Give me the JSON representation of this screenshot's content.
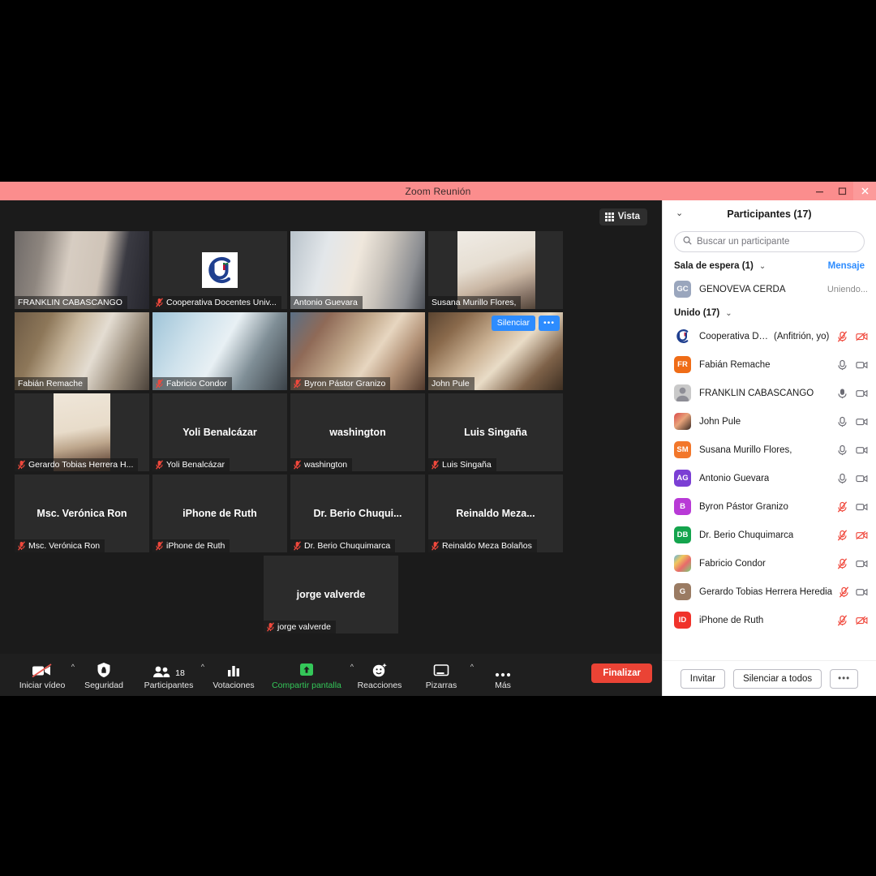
{
  "window": {
    "title": "Zoom Reunión",
    "controls": {
      "minimize": "minimize-icon",
      "maximize": "maximize-icon",
      "close": "close-icon"
    }
  },
  "meeting": {
    "view_button": "Vista",
    "tiles": [
      [
        {
          "name": "FRANKLIN CABASCANGO",
          "label": "FRANKLIN CABASCANGO",
          "muted": false,
          "active": true,
          "video": true,
          "photo": "frame-a"
        },
        {
          "name": "Cooperativa Docentes Univ...",
          "label": "Cooperativa Docentes Univ...",
          "muted": true,
          "active": false,
          "video": true,
          "photo": "coop-logo"
        },
        {
          "name": "Antonio Guevara",
          "label": "Antonio Guevara",
          "muted": false,
          "active": false,
          "video": true,
          "photo": "frame-c"
        },
        {
          "name": "Susana Murillo Flores,",
          "label": "Susana Murillo Flores,",
          "muted": false,
          "active": false,
          "video": true,
          "photo": "frame-d"
        }
      ],
      [
        {
          "name": "Fabián Remache",
          "label": "Fabián Remache",
          "muted": false,
          "active": false,
          "video": true,
          "photo": "frame-e"
        },
        {
          "name": "Fabricio Condor",
          "label": "Fabricio Condor",
          "muted": true,
          "active": false,
          "video": true,
          "photo": "frame-f"
        },
        {
          "name": "Byron Pástor Granizo",
          "label": "Byron Pástor Granizo",
          "muted": true,
          "active": false,
          "video": true,
          "photo": "frame-g"
        },
        {
          "name": "John Pule",
          "label": "John Pule",
          "muted": false,
          "active": false,
          "video": true,
          "photo": "frame-h",
          "hover": {
            "mute": "Silenciar",
            "more": "•••"
          }
        }
      ],
      [
        {
          "name": "Gerardo Tobias Herrera H...",
          "label": "Gerardo Tobias Herrera H...",
          "muted": true,
          "active": false,
          "video": true,
          "photo": "frame-i"
        },
        {
          "name": "Yoli Benalcázar",
          "label": "Yoli Benalcázar",
          "muted": true,
          "active": false,
          "video": false
        },
        {
          "name": "washington",
          "label": "washington",
          "muted": true,
          "active": false,
          "video": false
        },
        {
          "name": "Luis Singaña",
          "label": "Luis Singaña",
          "muted": true,
          "active": false,
          "video": false
        }
      ],
      [
        {
          "name": "Msc. Verónica Ron",
          "label": "Msc. Verónica Ron",
          "muted": true,
          "active": false,
          "video": false
        },
        {
          "name": "iPhone de Ruth",
          "label": "iPhone de Ruth",
          "muted": true,
          "active": false,
          "video": false
        },
        {
          "name": "Dr.  Berio Chuqui...",
          "label": "Dr. Berio Chuquimarca",
          "muted": true,
          "active": false,
          "video": false
        },
        {
          "name": "Reinaldo  Meza...",
          "label": "Reinaldo Meza Bolaños",
          "muted": true,
          "active": false,
          "video": false
        }
      ],
      [
        {
          "name": "jorge valverde",
          "label": "jorge valverde",
          "muted": true,
          "active": false,
          "video": false
        }
      ]
    ],
    "toolbar": {
      "video": {
        "label": "Iniciar vídeo",
        "icon": "camera-off-icon",
        "caret": true
      },
      "security": {
        "label": "Seguridad",
        "icon": "shield-icon",
        "caret": false
      },
      "participants": {
        "label": "Participantes",
        "icon": "people-icon",
        "count": "18",
        "caret": true
      },
      "polls": {
        "label": "Votaciones",
        "icon": "poll-bars-icon",
        "caret": false
      },
      "share": {
        "label": "Compartir pantalla",
        "icon": "share-screen-icon",
        "caret": true
      },
      "reactions": {
        "label": "Reacciones",
        "icon": "smiley-icon",
        "caret": false
      },
      "whiteboards": {
        "label": "Pizarras",
        "icon": "whiteboard-icon",
        "caret": true
      },
      "more": {
        "label": "Más",
        "icon": "ellipsis-icon",
        "caret": false
      },
      "end": {
        "label": "Finalizar"
      }
    }
  },
  "panel": {
    "title": "Participantes (17)",
    "search_placeholder": "Buscar un participante",
    "waiting_room": {
      "title": "Sala de espera (1)",
      "action": "Mensaje",
      "rows": [
        {
          "initials": "GC",
          "name": "GENOVEVA CERDA",
          "status": "Uniendo...",
          "color": "#9aa6bd"
        }
      ]
    },
    "joined": {
      "title": "Unido (17)",
      "rows": [
        {
          "initials": "",
          "name": "Cooperativa Doc...",
          "meta": "(Anfitrión, yo)",
          "color": "#ffffff",
          "avatar": "coop-logo",
          "mic": "muted",
          "cam": "off"
        },
        {
          "initials": "FR",
          "name": "Fabián Remache",
          "meta": "",
          "color": "#ef6c17",
          "mic": "on",
          "cam": "on"
        },
        {
          "initials": "",
          "name": "FRANKLIN CABASCANGO",
          "meta": "",
          "color": "#c9c9c9",
          "avatar": "person-silhouette",
          "mic": "on-active",
          "cam": "on"
        },
        {
          "initials": "",
          "name": "John Pule",
          "meta": "",
          "color": "#d94a4a",
          "avatar": "photo-avatar",
          "mic": "on",
          "cam": "on"
        },
        {
          "initials": "SM",
          "name": "Susana Murillo Flores,",
          "meta": "",
          "color": "#f2772b",
          "mic": "on",
          "cam": "on"
        },
        {
          "initials": "AG",
          "name": "Antonio Guevara",
          "meta": "",
          "color": "#7b3fd4",
          "mic": "on",
          "cam": "on"
        },
        {
          "initials": "B",
          "name": "Byron Pástor Granizo",
          "meta": "",
          "color": "#b83ad6",
          "mic": "muted",
          "cam": "on"
        },
        {
          "initials": "DB",
          "name": "Dr. Berio Chuquimarca",
          "meta": "",
          "color": "#14a44d",
          "mic": "muted",
          "cam": "off"
        },
        {
          "initials": "",
          "name": "Fabricio Condor",
          "meta": "",
          "color": "#5ab4e6",
          "avatar": "photo-avatar-2",
          "mic": "muted",
          "cam": "on"
        },
        {
          "initials": "G",
          "name": "Gerardo Tobias Herrera Heredia",
          "meta": "",
          "color": "#9a7b63",
          "mic": "muted",
          "cam": "on"
        },
        {
          "initials": "ID",
          "name": "iPhone de Ruth",
          "meta": "",
          "color": "#f0332b",
          "mic": "muted",
          "cam": "off"
        }
      ]
    },
    "footer": {
      "invite": "Invitar",
      "mute_all": "Silenciar a todos",
      "more": "•••"
    }
  },
  "colors": {
    "titlebar": "#fb8d8d",
    "accent_blue": "#2d8cff",
    "end_red": "#ea4335",
    "share_green": "#34c759",
    "active_border": "#c9f04a",
    "mute_red": "#f0483c"
  }
}
